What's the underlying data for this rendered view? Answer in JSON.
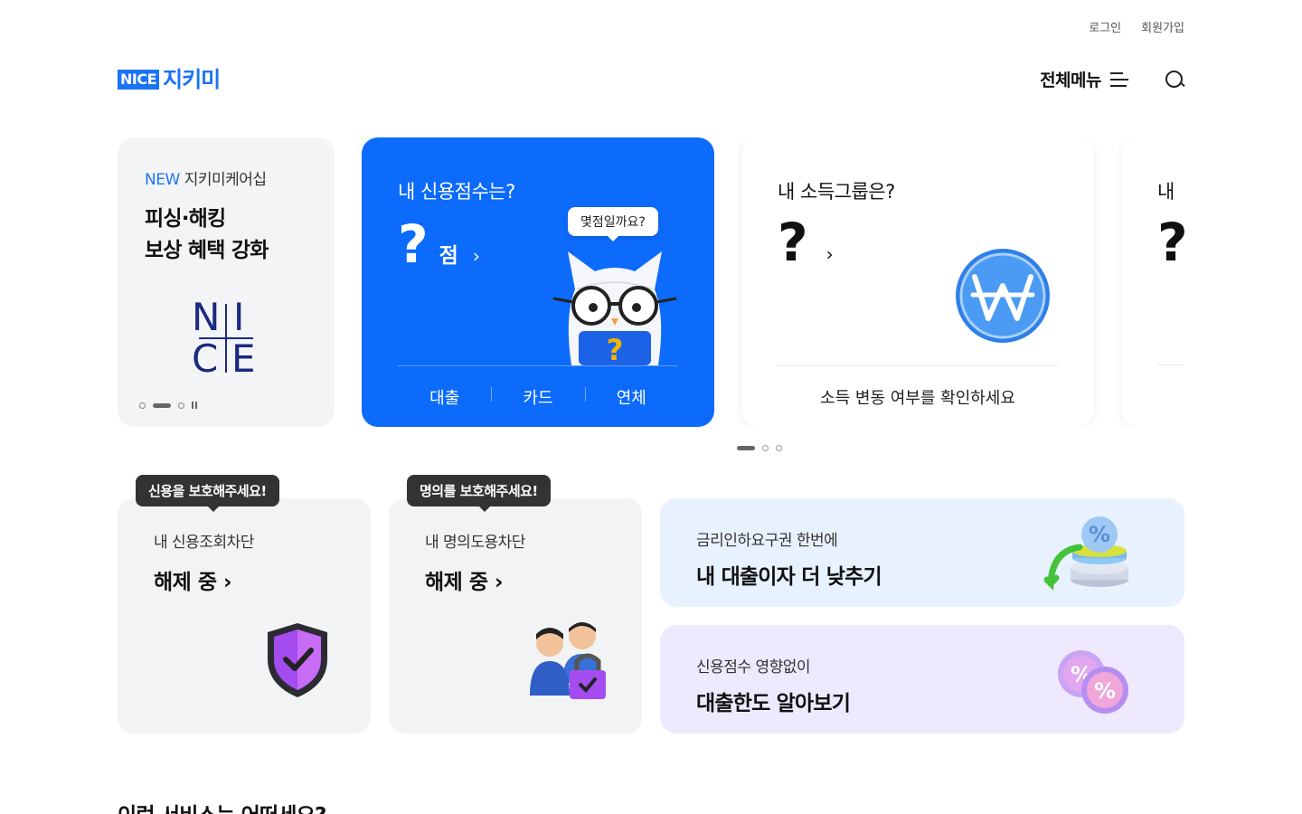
{
  "top_links": {
    "login": "로그인",
    "signup": "회원가입"
  },
  "header": {
    "logo_badge": "NICE",
    "logo_text": "지키미",
    "menu_label": "전체메뉴",
    "menu_icon": "hamburger-icon",
    "search_icon": "search-icon"
  },
  "carousel": {
    "promo": {
      "tag_new": "NEW",
      "tag_text": "지키미케어십",
      "title_line1": "피싱·해킹",
      "title_line2": "보상 혜택 강화",
      "mark_letters": [
        "N",
        "I",
        "C",
        "E"
      ]
    },
    "score_card": {
      "question": "내 신용점수는?",
      "value": "?",
      "unit": "점",
      "chevron": "›",
      "bubble": "몇점일까요?",
      "tabs": [
        "대출",
        "카드",
        "연체"
      ],
      "color": "#0c6bfb"
    },
    "income_card": {
      "question": "내 소득그룹은?",
      "value": "?",
      "chevron": "›",
      "footer": "소득 변동 여부를 확인하세요",
      "icon": "won-coin-icon"
    },
    "peek_card": {
      "question": "내 ",
      "value": "?"
    }
  },
  "lower": {
    "credit_lock": {
      "tooltip": "신용을 보호해주세요!",
      "label": "내 신용조회차단",
      "status": "해제 중",
      "chevron": "›",
      "icon": "shield-check-icon"
    },
    "identity_lock": {
      "tooltip": "명의를 보호해주세요!",
      "label": "내 명의도용차단",
      "status": "해제 중",
      "chevron": "›",
      "icon": "people-lock-icon"
    },
    "rate_cut": {
      "sub": "금리인하요구권 한번에",
      "title": "내 대출이자 더 낮추기",
      "icon": "percent-coins-icon",
      "bg": "#e8f1fe"
    },
    "loan_limit": {
      "sub": "신용점수 영향없이",
      "title": "대출한도 알아보기",
      "icon": "percent-badges-icon",
      "bg": "#efe9fd"
    }
  },
  "section_title": "이런 서비스는 어떠세요?"
}
